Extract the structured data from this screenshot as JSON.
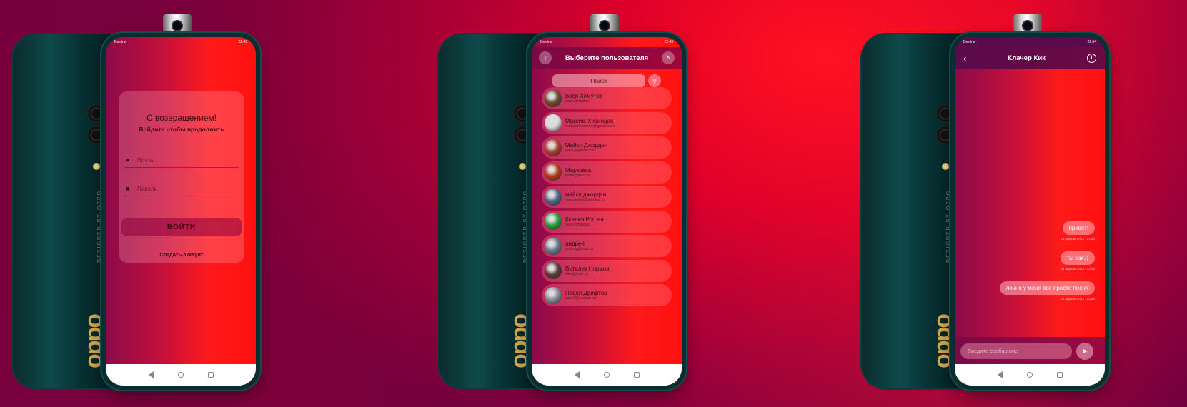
{
  "status": {
    "carrier": "Beeline",
    "time1": "22:49",
    "time2": "22:49",
    "time3": "22:54"
  },
  "login": {
    "title": "С возвращением!",
    "subtitle": "Войдите чтобы продолжить",
    "email_placeholder": "Почта",
    "password_placeholder": "Пароль",
    "login_button": "ВОЙТИ",
    "create_account": "Создать аккаунт"
  },
  "users": {
    "title": "Выберите пользователя",
    "search_placeholder": "Поиск",
    "items": [
      {
        "name": "Вася Хомутов",
        "email": "vasu@mail.ru",
        "color": "#6b4b2a"
      },
      {
        "name": "Максим Хивинцев",
        "email": "maksikhivintsev@gmail.com",
        "color": "#dcdcdc"
      },
      {
        "name": "Майкл Джордон",
        "email": "mike@gmail.com",
        "color": "#a8402a"
      },
      {
        "name": "Марковка",
        "email": "mark@mail.ru",
        "color": "#b83a1a"
      },
      {
        "name": "майкл джордан",
        "email": "dwdgeydw@yandex.ru",
        "color": "#4a6a8a"
      },
      {
        "name": "Ксения Рогова",
        "email": "ksen@mail.ru",
        "color": "#1ea43a"
      },
      {
        "name": "андрей",
        "email": "andrey@mail.ru",
        "color": "#6a7a8a"
      },
      {
        "name": "Виталик Нормов",
        "email": "vital@mail.ru",
        "color": "#5a3a3a"
      },
      {
        "name": "Павел Дрифтов",
        "email": "pavel@yandex.ru",
        "color": "#8a8a9a"
      }
    ]
  },
  "chat": {
    "title": "Клачер Кик",
    "messages": [
      {
        "text": "привет!",
        "time": "28 апреля 2023 - 22:53"
      },
      {
        "text": "ты как?)",
        "time": "28 апреля 2023 - 22:53"
      },
      {
        "text": "лично у меня все просто песня",
        "time": "28 апреля 2023 - 22:54"
      }
    ],
    "input_placeholder": "Введите сообщение"
  },
  "device": {
    "brand": "oppo",
    "tagline": "DESIGNED BY OPPO"
  },
  "icons": [
    "back-icon",
    "collapse-icon",
    "search-icon",
    "info-icon",
    "send-icon",
    "user-icon",
    "lock-icon",
    "nav-back-icon",
    "nav-home-icon",
    "nav-recents-icon"
  ]
}
